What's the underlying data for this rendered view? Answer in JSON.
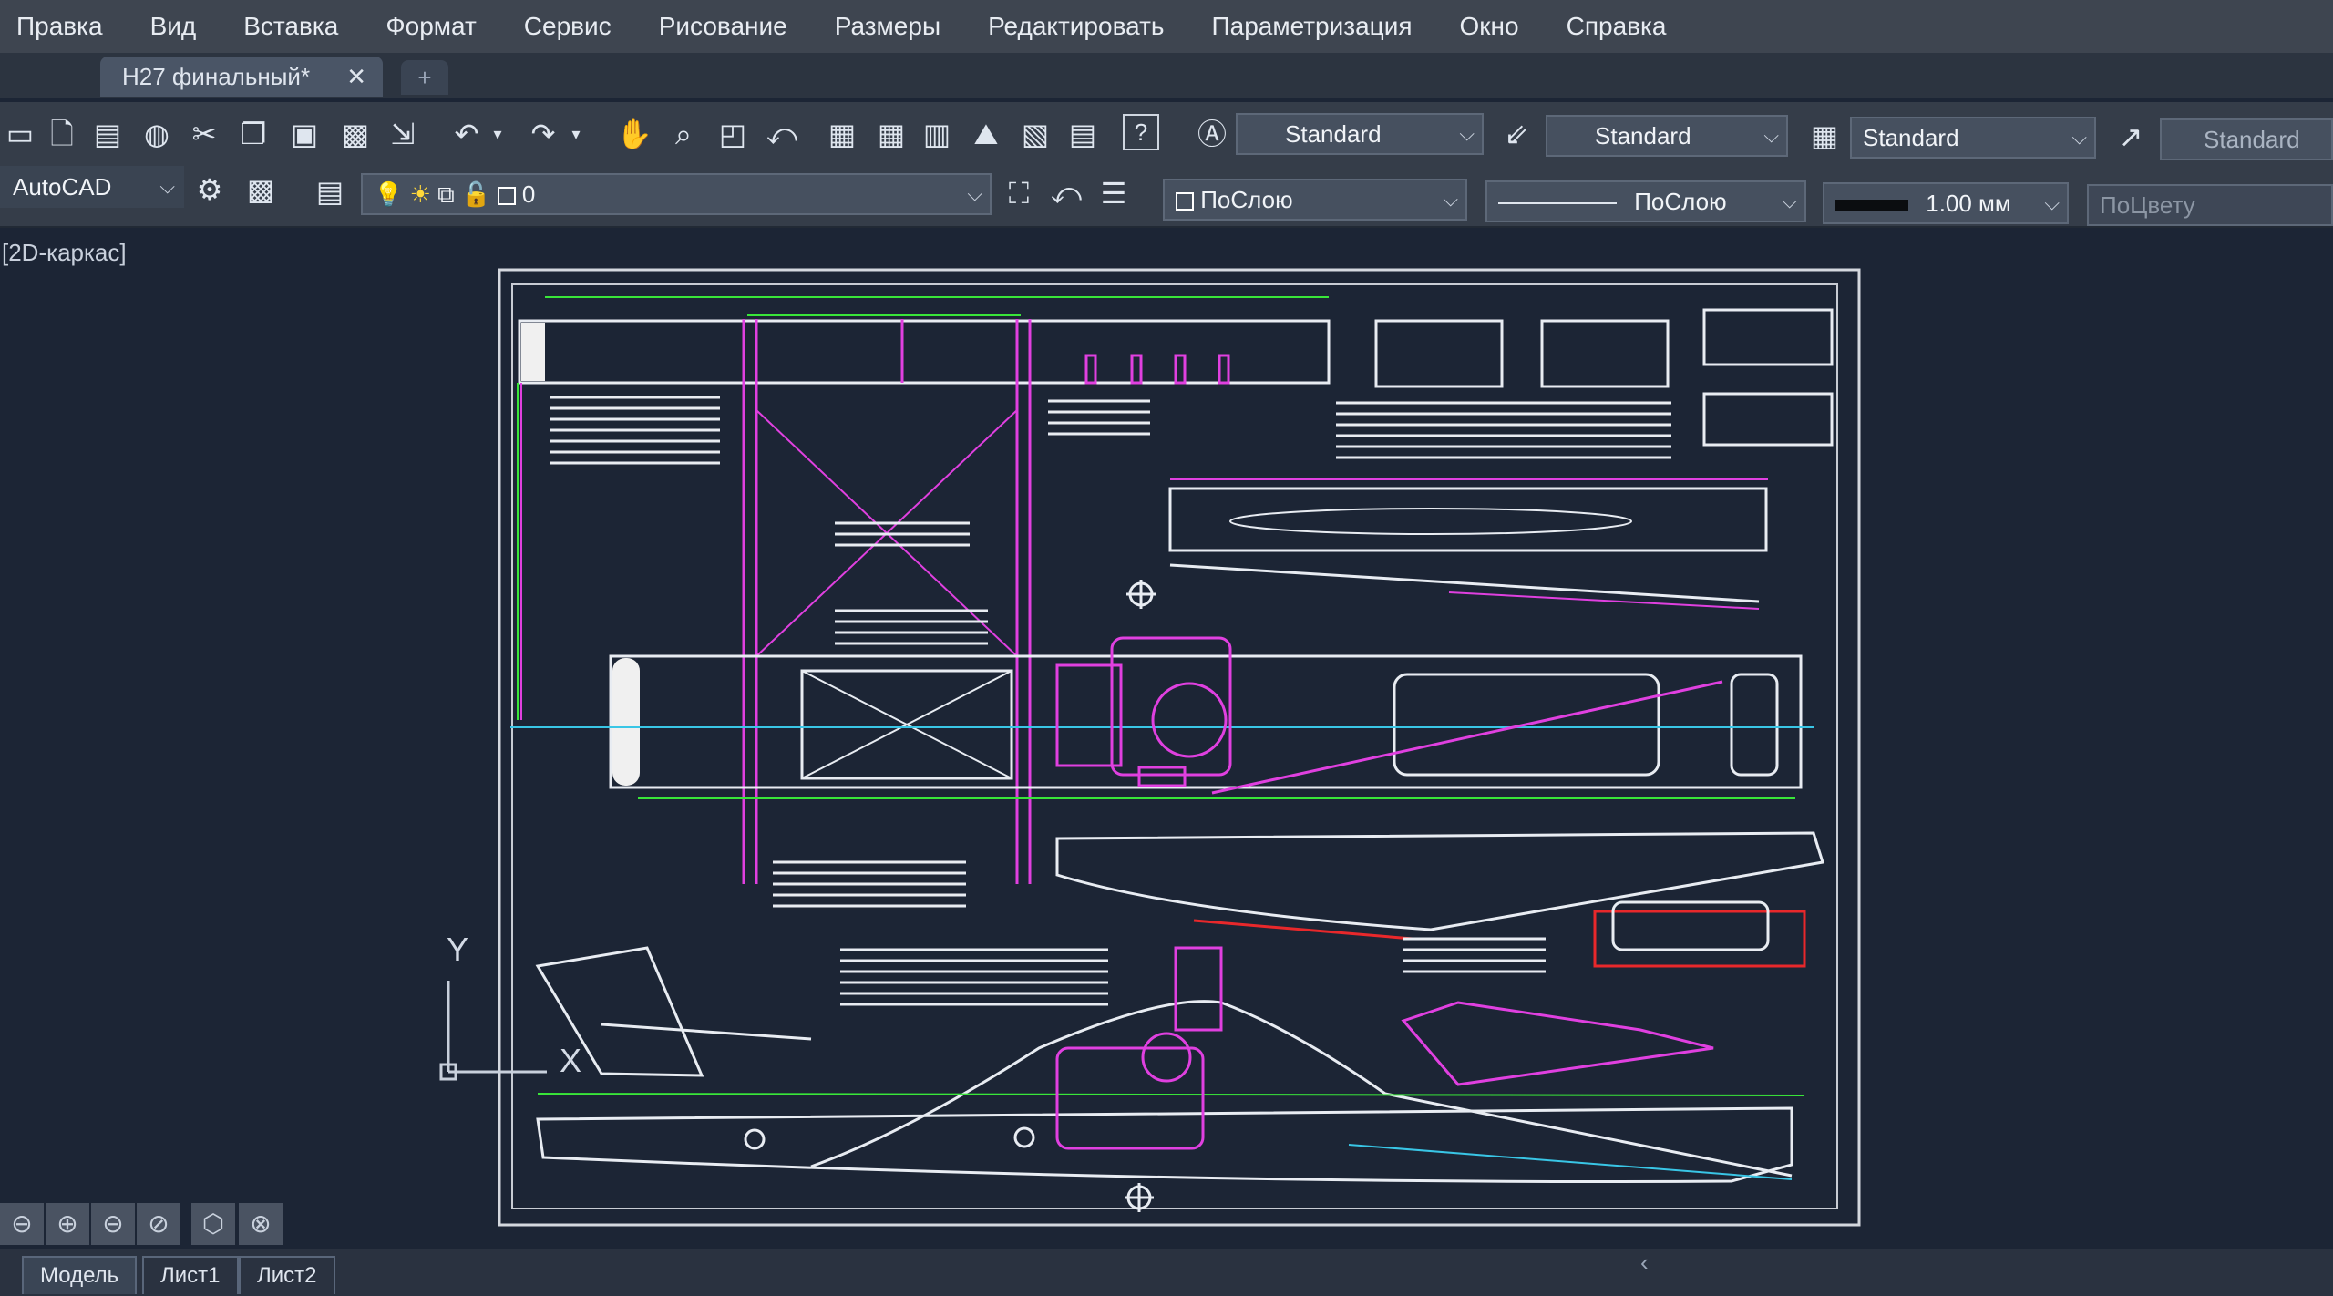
{
  "menu": [
    "Правка",
    "Вид",
    "Вставка",
    "Формат",
    "Сервис",
    "Рисование",
    "Размеры",
    "Редактировать",
    "Параметризация",
    "Окно",
    "Справка"
  ],
  "document_tab": {
    "title": "Н27 финальный*",
    "close": "✕",
    "new_tab": "+"
  },
  "workspace": {
    "name": "AutoCAD"
  },
  "layer": {
    "value": "0"
  },
  "styles": {
    "text": "Standard",
    "dimension": "Standard",
    "table": "Standard",
    "multileader": "Standard"
  },
  "properties": {
    "color": "ПоСлою",
    "linetype": "ПоСлою",
    "lineweight": "1.00 мм",
    "plotstyle": "ПоЦвету"
  },
  "viewport": {
    "label": "[2D-каркас]"
  },
  "ucs": {
    "y_label": "Y",
    "x_label": "X"
  },
  "layout_tabs": [
    "Модель",
    "Лист1",
    "Лист2"
  ],
  "icons": [
    "new-icon",
    "open-icon",
    "save-icon",
    "plot-icon",
    "cut-icon",
    "copy-icon",
    "paste-icon",
    "match-properties-icon",
    "undo-icon",
    "redo-icon",
    "pan-icon",
    "zoom-realtime-icon",
    "zoom-window-icon",
    "zoom-previous-icon",
    "properties-icon",
    "design-center-icon",
    "tool-palettes-icon",
    "sheet-set-icon",
    "markup-icon",
    "calculator-icon",
    "help-icon",
    "text-style-icon",
    "dimension-style-icon",
    "table-style-icon",
    "multileader-style-icon",
    "workspace-settings-icon",
    "layer-properties-icon",
    "bulb-icon",
    "sun-icon",
    "lock-icon"
  ]
}
